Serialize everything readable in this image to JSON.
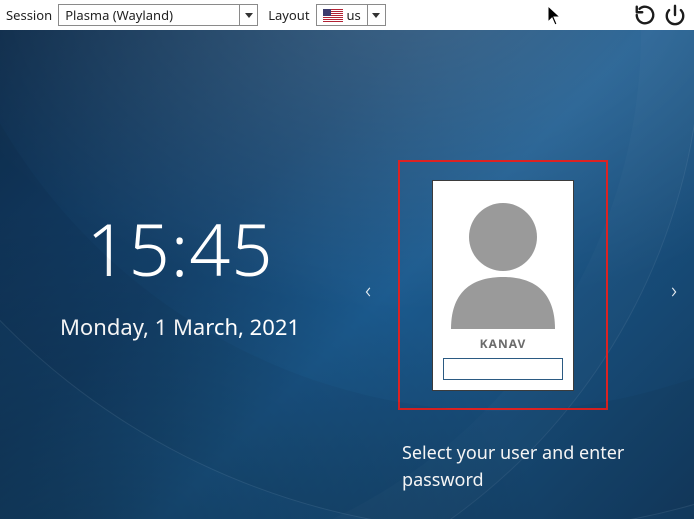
{
  "topbar": {
    "session_label": "Session",
    "session_value": "Plasma (Wayland)",
    "layout_label": "Layout",
    "layout_value": "us",
    "layout_flag": "us"
  },
  "clock": {
    "time": "15:45",
    "date": "Monday, 1 March, 2021"
  },
  "login": {
    "username": "KANAV",
    "password_value": "",
    "prompt": "Select your user and enter password"
  },
  "icons": {
    "reload": "reload-icon",
    "power": "power-icon",
    "prev": "‹",
    "next": "›"
  }
}
